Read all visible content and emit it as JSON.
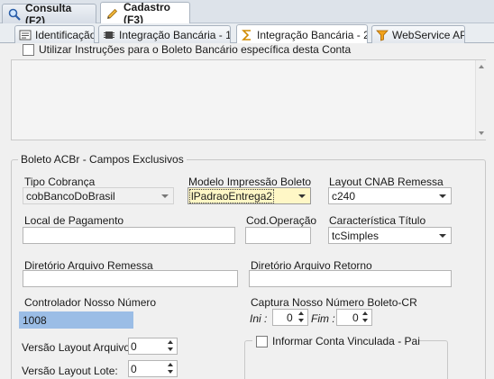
{
  "top_tabs": [
    {
      "label": "Consulta (F2)",
      "icon": "magnifier-icon"
    },
    {
      "label": "Cadastro (F3)",
      "icon": "pencil-icon"
    }
  ],
  "sub_tabs": [
    {
      "label": "Identificação",
      "icon": "id-card-icon"
    },
    {
      "label": "Integração Bancária - 1",
      "icon": "chip-icon"
    },
    {
      "label": "Integração Bancária - 2",
      "icon": "sigma-icon"
    },
    {
      "label": "WebService API",
      "icon": "funnel-icon"
    }
  ],
  "instructions": {
    "checkbox_label": "Utilizar Instruções para o Boleto Bancário específica desta Conta",
    "checked": false
  },
  "acbr_group": {
    "title": "Boleto ACBr - Campos Exclusivos",
    "tipo_cobranca": {
      "label": "Tipo Cobrança",
      "value": "cobBancoDoBrasil"
    },
    "modelo_impressao": {
      "label": "Modelo Impressão Boleto",
      "value": "lPadraoEntrega2"
    },
    "layout_cnab": {
      "label": "Layout CNAB Remessa",
      "value": "c240"
    },
    "local_pagamento": {
      "label": "Local de Pagamento",
      "value": ""
    },
    "cod_operacao": {
      "label": "Cod.Operação",
      "value": ""
    },
    "caracteristica_titulo": {
      "label": "Característica Título",
      "value": "tcSimples"
    },
    "dir_remessa": {
      "label": "Diretório Arquivo Remessa",
      "value": ""
    },
    "dir_retorno": {
      "label": "Diretório Arquivo Retorno",
      "value": ""
    },
    "controlador": {
      "label": "Controlador Nosso Número",
      "value": "1008"
    },
    "captura": {
      "label": "Captura Nosso Número Boleto-CR",
      "ini_label": "Ini :",
      "ini_value": "0",
      "fim_label": "Fim :",
      "fim_value": "0"
    },
    "versao_arquivo": {
      "label": "Versão Layout Arquivo:",
      "value": "0"
    },
    "versao_lote": {
      "label": "Versão Layout Lote:",
      "value": "0"
    },
    "conta_vinculada": {
      "label": "Informar Conta Vinculada - Pai",
      "checked": false
    }
  },
  "colors": {
    "accent_tab": "#ffffff",
    "selection_highlight": "#9bbde6",
    "focus_combo": "#fff7c6"
  }
}
